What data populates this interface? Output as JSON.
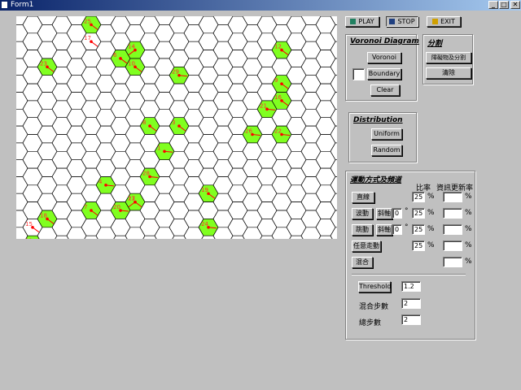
{
  "window": {
    "title": "Form1",
    "min_label": "_",
    "max_label": "□",
    "close_label": "✕"
  },
  "toolbar": {
    "play_label": "PLAY",
    "stop_label": "STOP",
    "exit_label": "EXIT"
  },
  "voronoi": {
    "title": "Voronoi Diagram",
    "voronoi_label": "Voronoi",
    "boundary_label": "Boundary",
    "clear_label": "Clear",
    "color_swatch": "#ffffff"
  },
  "partition": {
    "title": "分割",
    "obstacle_label": "障礙物及分割",
    "clear_label": "清除"
  },
  "distribution": {
    "title": "Distribution",
    "uniform_label": "Uniform",
    "random_label": "Random"
  },
  "motion": {
    "title": "運動方式及頻道",
    "ratio_header": "比率",
    "update_header": "資訊更新率",
    "straight": {
      "label": "直線",
      "ratio": "25",
      "pct": "%",
      "update": "",
      "update_pct": "%"
    },
    "wave": {
      "label": "波動",
      "slant_label": "斜軸",
      "angle": "0",
      "deg": "°",
      "ratio": "25",
      "pct": "%",
      "update": "",
      "update_pct": "%"
    },
    "jump": {
      "label": "跳動",
      "slant_label": "斜軸",
      "angle": "0",
      "deg": "°",
      "ratio": "25",
      "pct": "%",
      "update": "",
      "update_pct": "%"
    },
    "random": {
      "label": "任意走動",
      "ratio": "25",
      "pct": "%",
      "update": "",
      "update_pct": "%"
    },
    "mixed": {
      "label": "混合",
      "update": "",
      "update_pct": "%"
    }
  },
  "threshold": {
    "label": "Threshold",
    "value": "1.2"
  },
  "mix_steps": {
    "label": "混合步數",
    "value": "2"
  },
  "total_steps": {
    "label": "總步數",
    "value": "2"
  },
  "colors": {
    "accent": "#80ff20",
    "node": "#ff0000",
    "label": "#ff3030",
    "grid": "#000000"
  },
  "nodes": [
    {
      "id": "25",
      "row": 0,
      "col": 5,
      "tail": "dr",
      "highlight": true
    },
    {
      "id": "17",
      "row": 1,
      "col": 5,
      "tail": "dr",
      "highlight": false
    },
    {
      "id": "6",
      "row": 2,
      "col": 7,
      "tail": "dr",
      "highlight": true
    },
    {
      "id": "14",
      "row": 2,
      "col": 8,
      "tail": "dl",
      "highlight": true
    },
    {
      "id": "10",
      "row": 3,
      "col": 8,
      "tail": "dr",
      "highlight": true
    },
    {
      "id": "12",
      "row": 2,
      "col": 18,
      "tail": "dr",
      "highlight": true
    },
    {
      "id": "23",
      "row": 3,
      "col": 2,
      "tail": "dr",
      "highlight": true
    },
    {
      "id": "29",
      "row": 3,
      "col": 11,
      "tail": "r",
      "highlight": true
    },
    {
      "id": "9",
      "row": 4,
      "col": 18,
      "tail": "dr",
      "highlight": true
    },
    {
      "id": "21",
      "row": 5,
      "col": 17,
      "tail": "r",
      "highlight": true
    },
    {
      "id": "16",
      "row": 5,
      "col": 18,
      "tail": "dr",
      "highlight": true
    },
    {
      "id": "8",
      "row": 6,
      "col": 9,
      "tail": "dr",
      "highlight": true
    },
    {
      "id": "3",
      "row": 6,
      "col": 11,
      "tail": "dr",
      "highlight": true
    },
    {
      "id": "26",
      "row": 7,
      "col": 16,
      "tail": "r",
      "highlight": true
    },
    {
      "id": "22",
      "row": 7,
      "col": 18,
      "tail": "r",
      "highlight": true
    },
    {
      "id": "1",
      "row": 8,
      "col": 10,
      "tail": "r",
      "highlight": true
    },
    {
      "id": "28",
      "row": 9,
      "col": 9,
      "tail": "r",
      "highlight": true
    },
    {
      "id": "4",
      "row": 10,
      "col": 6,
      "tail": "r",
      "highlight": true
    },
    {
      "id": "19",
      "row": 10,
      "col": 13,
      "tail": "dr",
      "highlight": true
    },
    {
      "id": "20",
      "row": 11,
      "col": 7,
      "tail": "r",
      "highlight": true
    },
    {
      "id": "27",
      "row": 11,
      "col": 8,
      "tail": "dl",
      "highlight": true
    },
    {
      "id": "13",
      "row": 11,
      "col": 8,
      "tail": "dr",
      "highlight": true
    },
    {
      "id": "7",
      "row": 11,
      "col": 5,
      "tail": "dr",
      "highlight": true
    },
    {
      "id": "15",
      "row": 12,
      "col": 1,
      "tail": "dr",
      "highlight": false
    },
    {
      "id": "18",
      "row": 12,
      "col": 2,
      "tail": "dr",
      "highlight": true
    },
    {
      "id": "24",
      "row": 12,
      "col": 13,
      "tail": "r",
      "highlight": true
    },
    {
      "id": "11",
      "row": 13,
      "col": 1,
      "tail": "dr",
      "highlight": true
    },
    {
      "id": "30",
      "row": 14,
      "col": 8,
      "tail": "r",
      "highlight": true
    },
    {
      "id": "2",
      "row": 16,
      "col": 14,
      "tail": "r",
      "highlight": true
    }
  ]
}
